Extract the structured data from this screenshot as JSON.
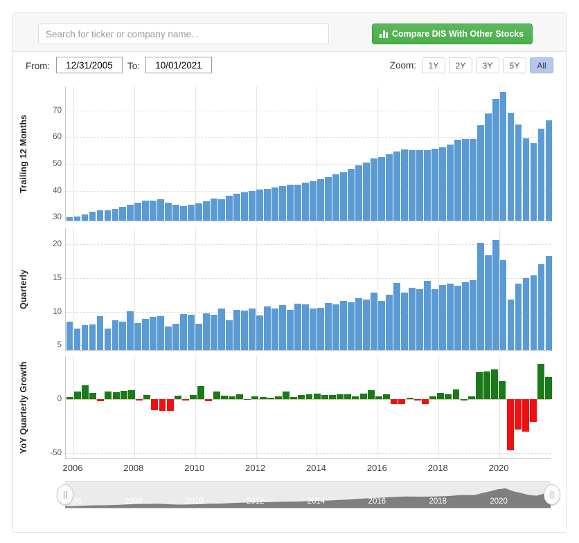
{
  "search": {
    "placeholder": "Search for ticker or company name...",
    "value": ""
  },
  "compare_button": {
    "label": "Compare DIS With Other Stocks",
    "icon": "bar-chart-icon",
    "color": "#47a447"
  },
  "controls": {
    "from_label": "From:",
    "from_value": "12/31/2005",
    "to_label": "To:",
    "to_value": "10/01/2021",
    "zoom_label": "Zoom:",
    "zoom_options": [
      "1Y",
      "2Y",
      "3Y",
      "5Y",
      "All"
    ],
    "zoom_selected": "All"
  },
  "navigator": {
    "xlabels": [
      "2006",
      "2008",
      "2010",
      "2012",
      "2014",
      "2016",
      "2018",
      "2020"
    ],
    "left_handle": "navigator-left-handle",
    "right_handle": "navigator-right-handle",
    "series_color": "#7f7f7f",
    "track_color": "#ebebeb"
  },
  "colors": {
    "bar_blue": "#5b9bd5",
    "bar_green": "#1a7a1a",
    "bar_red": "#ee1111",
    "grid": "#dcdcdc"
  },
  "chart_data": [
    {
      "type": "bar",
      "title": "",
      "ylabel": "Trailing 12 Months",
      "xlabel": "",
      "ylim": [
        28.5,
        79
      ],
      "yticks": [
        30,
        40,
        50,
        60,
        70
      ],
      "xlim": [
        2005.75,
        2021.75
      ],
      "xticks": [
        2006,
        2008,
        2010,
        2012,
        2014,
        2016,
        2018,
        2020
      ],
      "grid": true,
      "bar_color": "#5b9bd5",
      "x": [
        2005.9,
        2006.15,
        2006.4,
        2006.65,
        2006.9,
        2007.15,
        2007.4,
        2007.65,
        2007.9,
        2008.15,
        2008.4,
        2008.65,
        2008.9,
        2009.15,
        2009.4,
        2009.65,
        2009.9,
        2010.15,
        2010.4,
        2010.65,
        2010.9,
        2011.15,
        2011.4,
        2011.65,
        2011.9,
        2012.15,
        2012.4,
        2012.65,
        2012.9,
        2013.15,
        2013.4,
        2013.65,
        2013.9,
        2014.15,
        2014.4,
        2014.65,
        2014.9,
        2015.15,
        2015.4,
        2015.65,
        2015.9,
        2016.15,
        2016.4,
        2016.65,
        2016.9,
        2017.15,
        2017.4,
        2017.65,
        2017.9,
        2018.15,
        2018.4,
        2018.65,
        2018.9,
        2019.15,
        2019.4,
        2019.65,
        2019.9,
        2020.15,
        2020.4,
        2020.65,
        2020.9,
        2021.15,
        2021.4
      ],
      "values": [
        30.0,
        30.3,
        31.0,
        32.1,
        32.6,
        32.6,
        33.2,
        33.9,
        34.7,
        35.6,
        36.2,
        36.2,
        36.8,
        35.5,
        34.6,
        34.3,
        34.6,
        35.2,
        36.0,
        37.1,
        36.9,
        38.0,
        38.9,
        39.5,
        40.0,
        40.4,
        40.6,
        41.3,
        41.8,
        42.1,
        42.3,
        43.1,
        43.4,
        44.2,
        45.0,
        46.0,
        46.9,
        48.1,
        49.4,
        50.5,
        52.1,
        52.5,
        53.6,
        54.7,
        55.4,
        55.3,
        55.1,
        55.3,
        55.6,
        56.1,
        57.3,
        59.1,
        59.4,
        59.4,
        64.6,
        69.0,
        74.4,
        76.8,
        69.2,
        64.7,
        59.6,
        57.7,
        63.2,
        66.4
      ]
    },
    {
      "type": "bar",
      "title": "",
      "ylabel": "Quarterly",
      "xlabel": "",
      "ylim": [
        4.2,
        22.5
      ],
      "yticks": [
        5,
        10,
        15,
        20
      ],
      "xlim": [
        2005.75,
        2021.75
      ],
      "xticks": [
        2006,
        2008,
        2010,
        2012,
        2014,
        2016,
        2018,
        2020
      ],
      "grid": true,
      "bar_color": "#5b9bd5",
      "x": [
        2005.9,
        2006.15,
        2006.4,
        2006.65,
        2006.9,
        2007.15,
        2007.4,
        2007.65,
        2007.9,
        2008.15,
        2008.4,
        2008.65,
        2008.9,
        2009.15,
        2009.4,
        2009.65,
        2009.9,
        2010.15,
        2010.4,
        2010.65,
        2010.9,
        2011.15,
        2011.4,
        2011.65,
        2011.9,
        2012.15,
        2012.4,
        2012.65,
        2012.9,
        2013.15,
        2013.4,
        2013.65,
        2013.9,
        2014.15,
        2014.4,
        2014.65,
        2014.9,
        2015.15,
        2015.4,
        2015.65,
        2015.9,
        2016.15,
        2016.4,
        2016.65,
        2016.9,
        2017.15,
        2017.4,
        2017.65,
        2017.9,
        2018.15,
        2018.4,
        2018.65,
        2018.9,
        2019.15,
        2019.4,
        2019.65,
        2019.9,
        2020.15,
        2020.4,
        2020.65,
        2020.9,
        2021.15,
        2021.4
      ],
      "values": [
        8.5,
        7.5,
        8.0,
        8.1,
        9.3,
        7.5,
        8.7,
        8.5,
        10.1,
        8.3,
        8.9,
        9.2,
        9.3,
        7.8,
        8.2,
        9.6,
        9.5,
        8.2,
        9.8,
        9.5,
        10.5,
        8.7,
        10.3,
        10.2,
        10.5,
        9.4,
        10.8,
        10.5,
        11.0,
        10.3,
        11.2,
        11.1,
        10.5,
        10.6,
        11.3,
        11.1,
        11.6,
        11.4,
        12.0,
        11.8,
        12.8,
        11.6,
        12.5,
        14.3,
        12.8,
        13.6,
        13.4,
        14.6,
        13.3,
        14.0,
        14.2,
        13.9,
        14.4,
        14.7,
        20.2,
        18.4,
        20.6,
        17.7,
        11.8,
        14.2,
        15.0,
        15.4,
        17.0,
        18.3
      ]
    },
    {
      "type": "bar",
      "title": "",
      "ylabel": "YoY Quarterly Growth",
      "xlabel": "",
      "ylim": [
        -55,
        40
      ],
      "yticks": [
        0,
        -50
      ],
      "xlim": [
        2005.75,
        2021.75
      ],
      "xticks": [
        2006,
        2008,
        2010,
        2012,
        2014,
        2016,
        2018,
        2020
      ],
      "grid": false,
      "positive_color": "#1a7a1a",
      "negative_color": "#ee1111",
      "x": [
        2005.9,
        2006.15,
        2006.4,
        2006.65,
        2006.9,
        2007.15,
        2007.4,
        2007.65,
        2007.9,
        2008.15,
        2008.4,
        2008.65,
        2008.9,
        2009.15,
        2009.4,
        2009.65,
        2009.9,
        2010.15,
        2010.4,
        2010.65,
        2010.9,
        2011.15,
        2011.4,
        2011.65,
        2011.9,
        2012.15,
        2012.4,
        2012.65,
        2012.9,
        2013.15,
        2013.4,
        2013.65,
        2013.9,
        2014.15,
        2014.4,
        2014.65,
        2014.9,
        2015.15,
        2015.4,
        2015.65,
        2015.9,
        2016.15,
        2016.4,
        2016.65,
        2016.9,
        2017.15,
        2017.4,
        2017.65,
        2017.9,
        2018.15,
        2018.4,
        2018.65,
        2018.9,
        2019.15,
        2019.4,
        2019.65,
        2019.9,
        2020.15,
        2020.4,
        2020.65,
        2020.9,
        2021.15,
        2021.4
      ],
      "values": [
        2.0,
        7.0,
        13.0,
        6.0,
        -1.5,
        7.0,
        6.5,
        8.0,
        8.5,
        -1.0,
        4.0,
        -10.0,
        -10.5,
        -10.5,
        3.5,
        -1.0,
        4.0,
        12.5,
        -2.0,
        7.0,
        3.5,
        3.0,
        4.5,
        0.3,
        2.5,
        2.0,
        1.5,
        3.0,
        7.0,
        2.0,
        4.0,
        4.5,
        5.5,
        4.0,
        4.0,
        4.5,
        5.0,
        3.0,
        5.5,
        8.5,
        3.0,
        4.5,
        -4.0,
        -4.0,
        1.5,
        -0.3,
        -4.0,
        3.0,
        6.0,
        5.0,
        9.0,
        0.2,
        2.5,
        25.0,
        26.0,
        28.0,
        17.0,
        -47.0,
        -28.0,
        -30.0,
        -21.0,
        33.0,
        21.0
      ]
    }
  ]
}
